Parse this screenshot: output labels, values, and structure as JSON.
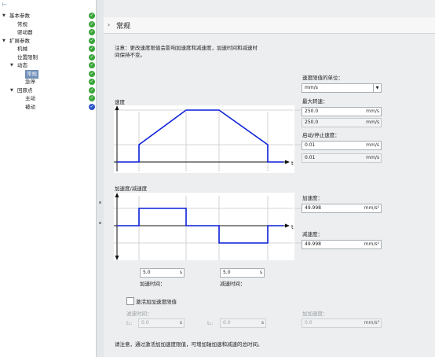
{
  "nav": {
    "top_icon": "⊢",
    "items": [
      {
        "label": "基本参数",
        "toggle": "▼",
        "level": 0,
        "status": "ok"
      },
      {
        "label": "常规",
        "toggle": "",
        "level": 1,
        "status": "ok"
      },
      {
        "label": "驱动器",
        "toggle": "",
        "level": 1,
        "status": "ok"
      },
      {
        "label": "扩展参数",
        "toggle": "▼",
        "level": 0,
        "status": "ok"
      },
      {
        "label": "机械",
        "toggle": "",
        "level": 1,
        "status": "ok"
      },
      {
        "label": "位置限制",
        "toggle": "",
        "level": 1,
        "status": "ok"
      },
      {
        "label": "动态",
        "toggle": "▼",
        "level": 1,
        "status": "ok"
      },
      {
        "label": "常规",
        "toggle": "",
        "level": 2,
        "status": "ok",
        "selected": true
      },
      {
        "label": "急停",
        "toggle": "",
        "level": 2,
        "status": "ok"
      },
      {
        "label": "回原点",
        "toggle": "▼",
        "level": 1,
        "status": "ok"
      },
      {
        "label": "主动",
        "toggle": "",
        "level": 2,
        "status": "ok"
      },
      {
        "label": "被动",
        "toggle": "",
        "level": 2,
        "status": "info"
      }
    ],
    "check_glyph": "✓"
  },
  "header": {
    "chevron": "›",
    "title": "常规"
  },
  "note": {
    "line1": "注意：更改速度限值会影响加速度和减速度，加速时间和减速时",
    "line2": "间保持不变。"
  },
  "velocity_unit": {
    "label": "速度限值的单位：",
    "value": "mm/s",
    "arrow": "▼"
  },
  "max_speed": {
    "label": "最大转速：",
    "value": "250.0",
    "unit": "mm/s",
    "readonly_value": "250.0",
    "readonly_unit": "mm/s"
  },
  "start_stop_speed": {
    "label": "启动/停止速度：",
    "value": "0.01",
    "unit": "mm/s",
    "readonly_value": "0.01",
    "readonly_unit": "mm/s"
  },
  "velocity_plot": {
    "title": "速度",
    "t_label": "t"
  },
  "accel_plot": {
    "title": "加速度/减速度",
    "t_label": "t"
  },
  "acceleration": {
    "label": "加速度：",
    "value": "49.998",
    "unit": "mm/s²"
  },
  "deceleration": {
    "label": "减速度：",
    "value": "49.998",
    "unit": "mm/s²"
  },
  "accel_time": {
    "value": "5.0",
    "unit": "s",
    "label": "加速时间："
  },
  "decel_time": {
    "value": "5.0",
    "unit": "s",
    "label": "减速时间："
  },
  "jerk": {
    "checkbox_label": "激活加加速度限值",
    "smoothing_label": "滤波时间：",
    "t1_label": "t₁:",
    "t1_value": "0.0",
    "t1_unit": "s",
    "t2_label": "t₂:",
    "t2_value": "0.0",
    "t2_unit": "s",
    "jerk_label": "加加速度：",
    "jerk_value": "0.0",
    "jerk_unit": "mm/s³"
  },
  "footer_note": "请注意，通过激活加加速度限值，可增加轴加速和减速的总时间。",
  "colors": {
    "accent": "#0a1fd8",
    "ok": "#3aa53a",
    "info": "#2f55c8",
    "selected": "#6f8fb8"
  }
}
